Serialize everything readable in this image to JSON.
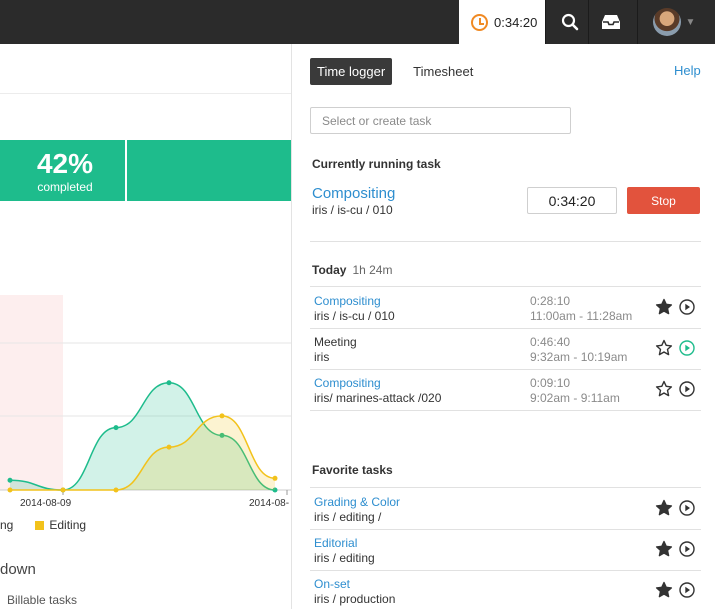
{
  "topbar": {
    "timer": "0:34:20",
    "icons": [
      "clock-icon",
      "search-icon",
      "inbox-icon",
      "avatar",
      "chevron-down-icon"
    ],
    "accent": "#f08a24"
  },
  "left": {
    "percent": "42%",
    "percent_label": "completed",
    "legend_editing": "Editing",
    "legend_prefix": "ng",
    "breakdown": "down",
    "billable": "Billable tasks"
  },
  "chart_data": {
    "type": "area",
    "x_tick_labels": [
      "2014-08-09",
      "2014-08-"
    ],
    "series": [
      {
        "name": "",
        "color": "#1ebc8c",
        "values": [
          0.05,
          0.0,
          0.32,
          0.55,
          0.28,
          0.0
        ]
      },
      {
        "name": "Editing",
        "color": "#f2c21b",
        "values": [
          0.0,
          0.0,
          0.0,
          0.22,
          0.38,
          0.06
        ]
      }
    ]
  },
  "right": {
    "tabs": [
      "Time logger",
      "Timesheet"
    ],
    "help": "Help",
    "task_placeholder": "Select or create task",
    "running_title": "Currently running task",
    "running": {
      "name": "Compositing",
      "path": "iris / is-cu / 010",
      "time": "0:34:20",
      "stop": "Stop"
    },
    "today_title": "Today",
    "today_total": "1h 24m",
    "today": [
      {
        "name": "Compositing",
        "path": "iris / is-cu / 010",
        "duration": "0:28:10",
        "range": "11:00am - 11:28am",
        "link": true,
        "starred": true,
        "play_active": false
      },
      {
        "name": "Meeting",
        "path": "iris",
        "duration": "0:46:40",
        "range": "9:32am - 10:19am",
        "link": false,
        "starred": false,
        "play_active": true
      },
      {
        "name": "Compositing",
        "path": "iris/ marines-attack /020",
        "duration": "0:09:10",
        "range": "9:02am - 9:11am",
        "link": true,
        "starred": false,
        "play_active": false
      }
    ],
    "favorites_title": "Favorite tasks",
    "favorites": [
      {
        "name": "Grading & Color",
        "path": "iris / editing /"
      },
      {
        "name": "Editorial",
        "path": "iris / editing"
      },
      {
        "name": "On-set",
        "path": "iris / production"
      }
    ],
    "colors": {
      "link": "#2e8ecf",
      "stop": "#e2533d",
      "active_play": "#1ebc8c"
    }
  }
}
